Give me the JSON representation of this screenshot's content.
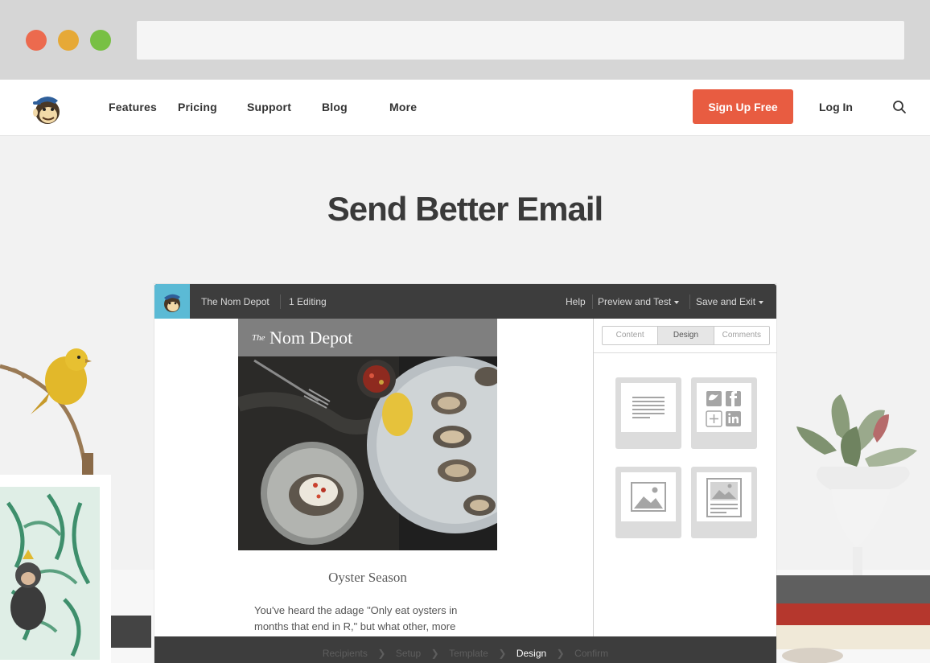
{
  "nav": {
    "links": [
      "Features",
      "Pricing",
      "Support",
      "Blog",
      "More"
    ],
    "signup_label": "Sign Up Free",
    "login_label": "Log In",
    "search_icon": "search-icon",
    "brand_color": "#e85c41"
  },
  "hero": {
    "title": "Send Better Email"
  },
  "app_bar": {
    "list_name": "The Nom Depot",
    "editing": "1 Editing",
    "help": "Help",
    "preview": "Preview and Test",
    "save": "Save and Exit"
  },
  "email": {
    "the": "The",
    "name": "Nom Depot",
    "heading": "Oyster Season",
    "body_line_1": "You've heard the adage \"Only eat oysters in",
    "body_line_2": "months that end in R,\" but what other, more"
  },
  "panel": {
    "tabs": [
      "Content",
      "Design",
      "Comments"
    ],
    "active_tab": "Design",
    "blocks": [
      "text-block-icon",
      "social-block-icon",
      "image-block-icon",
      "image-card-block-icon"
    ]
  },
  "steps": {
    "items": [
      "Recipients",
      "Setup",
      "Template",
      "Design",
      "Confirm"
    ],
    "active": "Design"
  }
}
